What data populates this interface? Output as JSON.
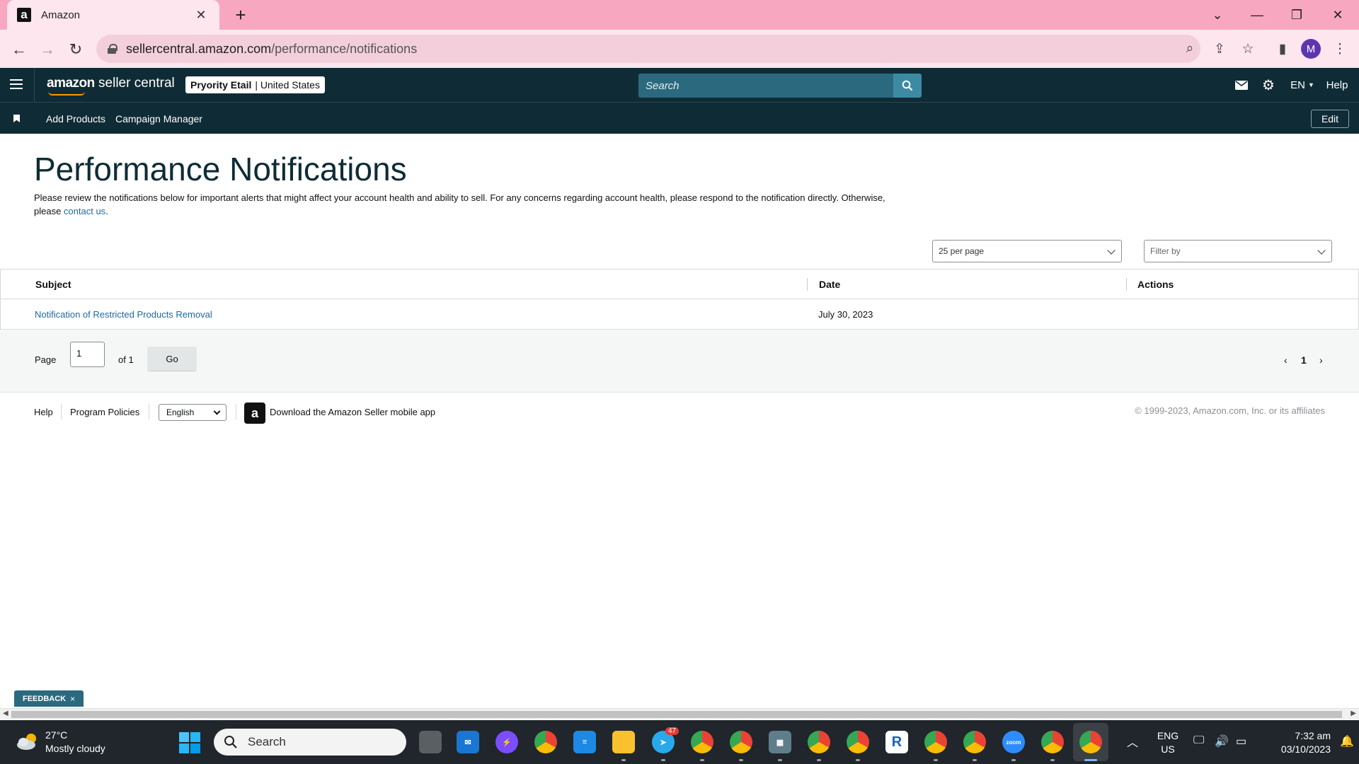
{
  "browser": {
    "tab_title": "Amazon",
    "tab_favicon": "a",
    "url_host": "sellercentral.amazon.com",
    "url_path": "/performance/notifications",
    "profile_initial": "M"
  },
  "header": {
    "brand_bold": "amazon",
    "brand_rest": " seller central",
    "account_name": "Pryority Etail",
    "account_region": "| United States",
    "search_placeholder": "Search",
    "language": "EN",
    "help": "Help"
  },
  "bookmarks": {
    "items": [
      "Add Products",
      "Campaign Manager"
    ],
    "edit": "Edit"
  },
  "page": {
    "title": "Performance Notifications",
    "intro_line1": "Please review the notifications below for important alerts that might affect your account health and ability to sell. For any concerns regarding account health, please respond to the notification directly. Otherwise,",
    "intro_please": "please ",
    "intro_link": "contact us",
    "intro_end": ".",
    "per_page": "25 per page",
    "filter_by": "Filter by"
  },
  "table": {
    "columns": [
      "Subject",
      "Date",
      "Actions"
    ],
    "rows": [
      {
        "subject": "Notification of Restricted Products Removal",
        "date": "July 30, 2023"
      }
    ]
  },
  "pager": {
    "page_label": "Page",
    "page_value": "1",
    "of_total": "of 1",
    "go": "Go",
    "current_page": "1"
  },
  "footer": {
    "help": "Help",
    "program_policies": "Program Policies",
    "language": "English",
    "download_app": "Download the Amazon Seller mobile app",
    "copyright": "© 1999-2023, Amazon.com, Inc. or its affiliates"
  },
  "feedback": {
    "label": "FEEDBACK",
    "close": "×"
  },
  "taskbar": {
    "temperature": "27°C",
    "weather": "Mostly cloudy",
    "search": "Search",
    "telegram_badge": "47",
    "lang_top": "ENG",
    "lang_bottom": "US",
    "time": "7:32 am",
    "date": "03/10/2023"
  },
  "colors": {
    "header_bg": "#0f2c36",
    "link": "#1b6aa8",
    "tabstrip": "#f7a8c0",
    "search_bg": "#2b6a7e"
  }
}
